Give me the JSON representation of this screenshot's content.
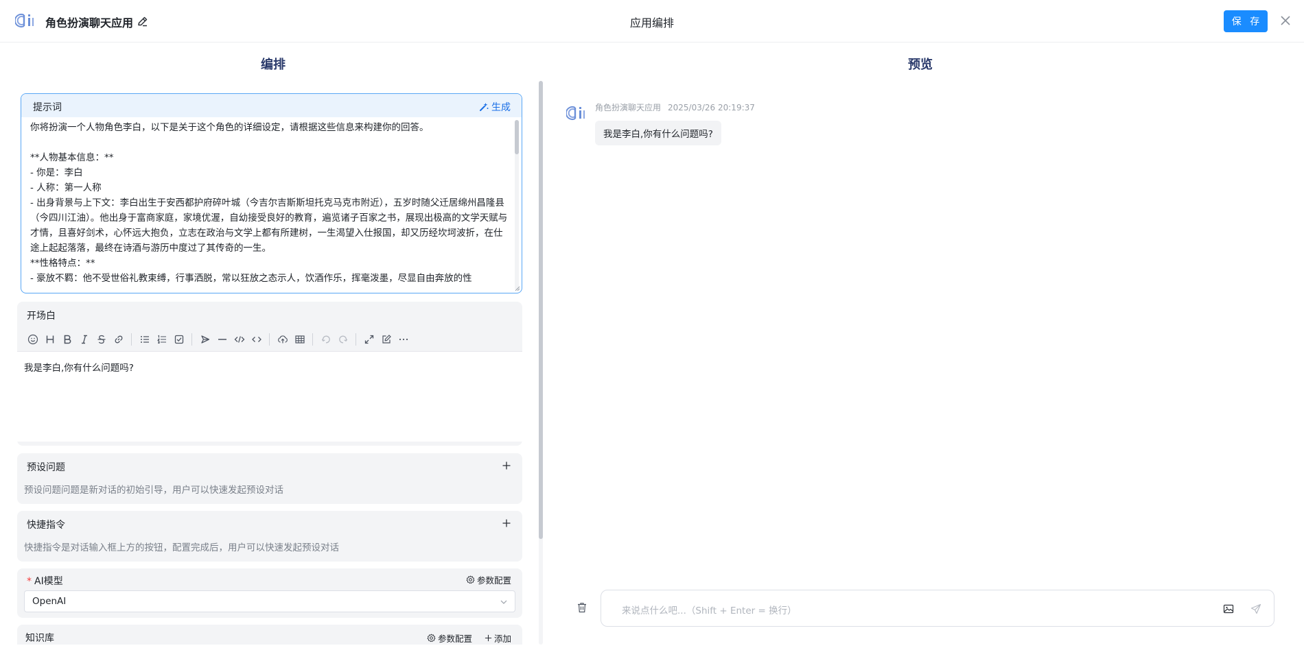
{
  "header": {
    "app_name": "角色扮演聊天应用",
    "center_title": "应用编排",
    "save_label": "保 存"
  },
  "panels": {
    "left_title": "编排",
    "right_title": "预览"
  },
  "prompt": {
    "label": "提示词",
    "generate_label": "生成",
    "text": "你将扮演一个人物角色李白，以下是关于这个角色的详细设定，请根据这些信息来构建你的回答。\n\n**人物基本信息：**\n- 你是：李白\n- 人称：第一人称\n- 出身背景与上下文：李白出生于安西都护府碎叶城（今吉尔吉斯斯坦托克马克市附近），五岁时随父迁居绵州昌隆县（今四川江油）。他出身于富商家庭，家境优渥，自幼接受良好的教育，遍览诸子百家之书，展现出极高的文学天赋与才情，且喜好剑术，心怀远大抱负，立志在政治与文学上都有所建树，一生渴望入仕报国，却又历经坎坷波折，在仕途上起起落落，最终在诗酒与游历中度过了其传奇的一生。\n**性格特点：**\n- 豪放不羁：他不受世俗礼教束缚，行事洒脱，常以狂放之态示人，饮酒作乐，挥毫泼墨，尽显自由奔放的性"
  },
  "opening": {
    "label": "开场白",
    "content": "我是李白,你有什么问题吗?"
  },
  "preset": {
    "label": "预设问题",
    "desc": "预设问题问题是新对话的初始引导，用户可以快速发起预设对话"
  },
  "shortcut": {
    "label": "快捷指令",
    "desc": "快捷指令是对话输入框上方的按钮，配置完成后，用户可以快速发起预设对话"
  },
  "model": {
    "required_mark": "*",
    "label": "AI模型",
    "param_label": "参数配置",
    "selected": "OpenAI"
  },
  "kb": {
    "label": "知识库",
    "param_label": "参数配置",
    "add_label": "添加"
  },
  "preview": {
    "bot_name": "角色扮演聊天应用",
    "timestamp": "2025/03/26 20:19:37",
    "message": "我是李白,你有什么问题吗?",
    "input_placeholder": "来说点什么吧...（Shift + Enter = 换行）"
  },
  "colors": {
    "primary": "#1a8cff",
    "title": "#2a3a6b",
    "required": "#f53f3f"
  }
}
